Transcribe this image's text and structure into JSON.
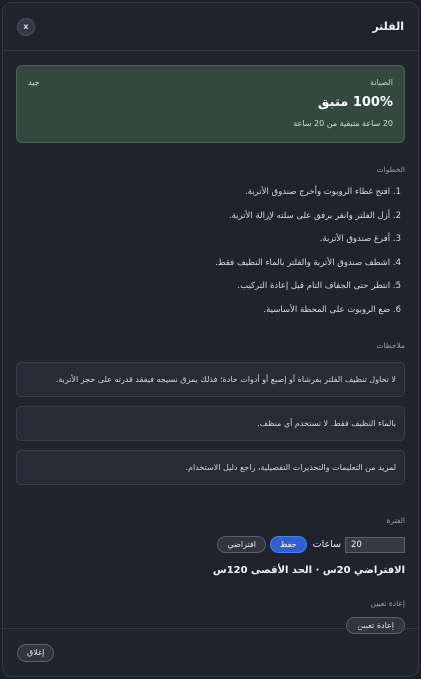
{
  "header": {
    "title": "الفلتر",
    "close_label": "x"
  },
  "maintenance": {
    "label": "الصيانة",
    "status": "جيد",
    "value": "100% متبق",
    "remaining": "20 ساعة متبقية من 20 ساعة"
  },
  "steps": {
    "label": "الخطوات",
    "items": [
      "1. افتح غطاء الروبوت وأخرج صندوق الأتربة.",
      "2. أزل الفلتر وانقر برفق على سلته لإزالة الأتربة.",
      "3. أفرغ صندوق الأتربة.",
      "4. اشطف صندوق الأتربة والفلتر بالماء النظيف فقط.",
      "5. انتظر حتى الجفاف التام قبل إعادة التركيب.",
      "6. ضع الروبوت على المحطة الأساسية."
    ]
  },
  "notes": {
    "label": "ملاحظات",
    "items": [
      "لا تحاول تنظيف الفلتر بفرشاة أو إصبع أو أدوات حادة؛ فذلك يمزق نسيجه فيفقد قدرته على حجز الأتربة.",
      "بالماء النظيف فقط. لا تستخدم أي منظف.",
      "لمزيد من التعليمات والتحذيرات التفصيلية، راجع دليل الاستخدام."
    ]
  },
  "period": {
    "label": "الفترة",
    "value": "20",
    "unit": "ساعات",
    "save_label": "حفظ",
    "default_label": "افتراضي",
    "limits": "الافتراضي 20س · الحد الأقصى 120س"
  },
  "reset": {
    "label": "إعادة تعيين",
    "button_label": "إعادة تعيين"
  },
  "footer": {
    "close_label": "إغلاق"
  }
}
